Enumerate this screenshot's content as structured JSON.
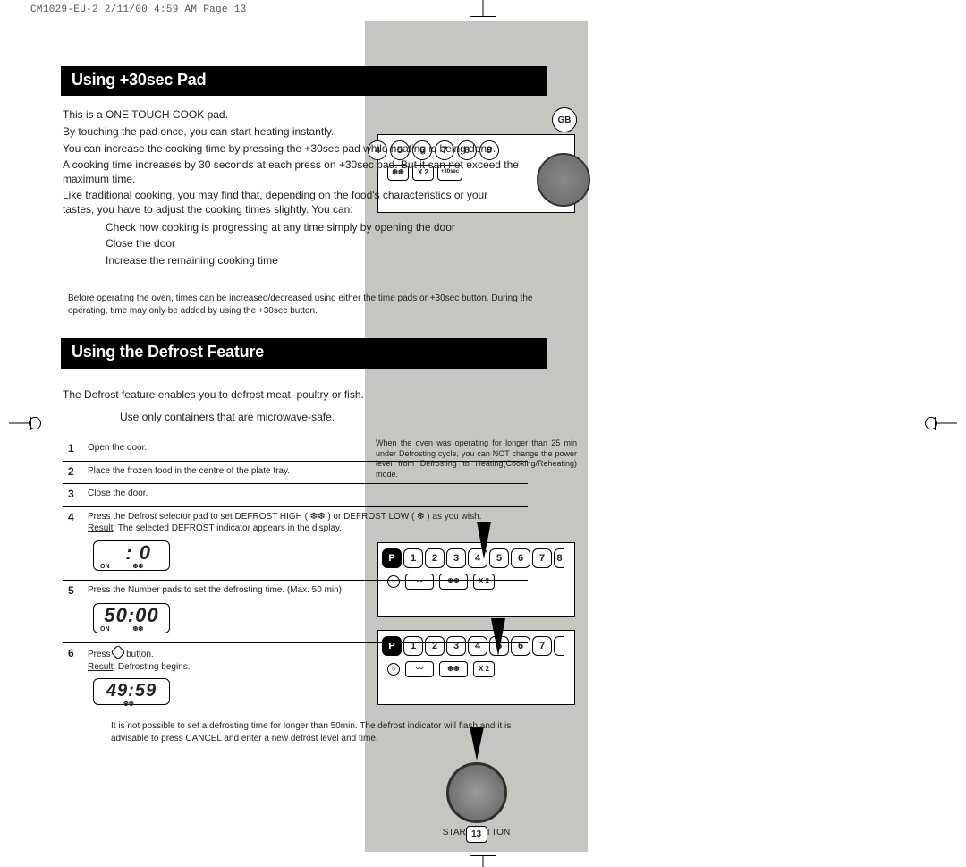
{
  "print_header": "CM1029-EU-2  2/11/00 4:59 AM  Page 13",
  "gb_label": "GB",
  "sec1": {
    "title": "Using +30sec Pad",
    "paras": [
      "This is a ONE TOUCH COOK pad.",
      "By touching the pad once, you can start heating instantly.",
      "You can increase the cooking time by pressing the +30sec pad while heating is being done.",
      "A cooking time increases by 30 seconds at each press on +30sec pad. But it can not exceed the maximum time.",
      "Like traditional cooking, you may find that, depending on the food's characteristics or your tastes, you have to adjust the cooking times slightly. You can:"
    ],
    "bullets": [
      "Check how cooking is progressing at any time simply by opening the door",
      "Close the door",
      "Increase the remaining cooking time"
    ],
    "note": "Before operating the oven, times can be increased/decreased using either the time pads or +30sec button. During the operating, time may only be added by using the +30sec button."
  },
  "sec2": {
    "title": "Using the Defrost Feature",
    "intro": "The Defrost feature enables you to defrost meat, poultry or fish.",
    "safe": "Use only containers that are microwave-safe.",
    "steps": [
      {
        "n": "1",
        "t": "Open the door."
      },
      {
        "n": "2",
        "t": "Place the frozen food in the centre of the plate tray."
      },
      {
        "n": "3",
        "t": "Close the door."
      },
      {
        "n": "4",
        "t": "Press the Defrost selector pad to set DEFROST HIGH ( ❆❆ ) or DEFROST LOW ( ❆ ) as you wish.",
        "res_label": "Result",
        "res": ": The selected DEFROST indicator appears in the display.",
        "lcd": ": 0",
        "tags": [
          "ON",
          "❆❆"
        ]
      },
      {
        "n": "5",
        "t": "Press the Number pads to set the defrosting time. (Max. 50 min)",
        "lcd": "50:00",
        "tags": [
          "ON",
          "❆❆"
        ]
      },
      {
        "n": "6",
        "t_pre": "Press ",
        "t_post": " button.",
        "res_label": "Result",
        "res": ": Defrosting begins.",
        "lcd": "49:59",
        "tags": [
          "",
          "❆❆"
        ]
      }
    ],
    "note": "It is not possible to set a defrosting time for longer than 50min. The defrost indicator will flash and it is advisable to press CANCEL and enter a new defrost level and time."
  },
  "panel1": {
    "keys": [
      "4",
      "5",
      "6",
      "7",
      "8",
      "9"
    ],
    "extras": [
      "❆❆",
      "X 2",
      "+30sec"
    ]
  },
  "panelPQ": {
    "keys": [
      "P",
      "1",
      "2",
      "3",
      "4",
      "5",
      "6",
      "7",
      "8"
    ],
    "row2": [
      "○",
      "〰",
      "❆❆",
      "X 2"
    ]
  },
  "dial_label": "START BUTTON",
  "right_note": "When the oven was operating for longer than 25 min under Defrosting cycle, you can NOT change the power level from Defrosting to Heating(Cooking/Reheating) mode.",
  "page_number": "13"
}
